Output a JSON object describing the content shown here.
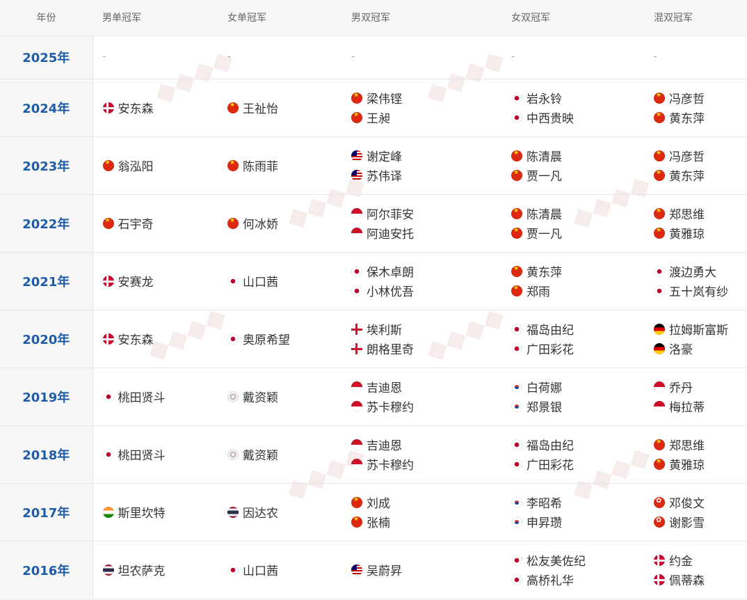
{
  "columns": [
    "年份",
    "男单冠军",
    "女单冠军",
    "男双冠军",
    "女双冠军",
    "混双冠军"
  ],
  "colors": {
    "year_text": "#1e5ba8",
    "header_bg": "#f7f7f7",
    "border": "#e6e6e6"
  },
  "rows": [
    {
      "year": "2025年",
      "ms": [],
      "ws": [],
      "md": [],
      "wd": [],
      "xd": [],
      "empty": "-"
    },
    {
      "year": "2024年",
      "ms": [
        {
          "flag": "dk",
          "name": "安东森"
        }
      ],
      "ws": [
        {
          "flag": "cn",
          "name": "王祉怡"
        }
      ],
      "md": [
        {
          "flag": "cn",
          "name": "梁伟铿"
        },
        {
          "flag": "cn",
          "name": "王昶"
        }
      ],
      "wd": [
        {
          "flag": "jp",
          "name": "岩永铃"
        },
        {
          "flag": "jp",
          "name": "中西贵映"
        }
      ],
      "xd": [
        {
          "flag": "cn",
          "name": "冯彦哲"
        },
        {
          "flag": "cn",
          "name": "黄东萍"
        }
      ]
    },
    {
      "year": "2023年",
      "ms": [
        {
          "flag": "cn",
          "name": "翁泓阳"
        }
      ],
      "ws": [
        {
          "flag": "cn",
          "name": "陈雨菲"
        }
      ],
      "md": [
        {
          "flag": "my",
          "name": "谢定峰"
        },
        {
          "flag": "my",
          "name": "苏伟译"
        }
      ],
      "wd": [
        {
          "flag": "cn",
          "name": "陈清晨"
        },
        {
          "flag": "cn",
          "name": "贾一凡"
        }
      ],
      "xd": [
        {
          "flag": "cn",
          "name": "冯彦哲"
        },
        {
          "flag": "cn",
          "name": "黄东萍"
        }
      ]
    },
    {
      "year": "2022年",
      "ms": [
        {
          "flag": "cn",
          "name": "石宇奇"
        }
      ],
      "ws": [
        {
          "flag": "cn",
          "name": "何冰娇"
        }
      ],
      "md": [
        {
          "flag": "id",
          "name": "阿尔菲安"
        },
        {
          "flag": "id",
          "name": "阿迪安托"
        }
      ],
      "wd": [
        {
          "flag": "cn",
          "name": "陈清晨"
        },
        {
          "flag": "cn",
          "name": "贾一凡"
        }
      ],
      "xd": [
        {
          "flag": "cn",
          "name": "郑思维"
        },
        {
          "flag": "cn",
          "name": "黄雅琼"
        }
      ]
    },
    {
      "year": "2021年",
      "ms": [
        {
          "flag": "dk",
          "name": "安赛龙"
        }
      ],
      "ws": [
        {
          "flag": "jp",
          "name": "山口茜"
        }
      ],
      "md": [
        {
          "flag": "jp",
          "name": "保木卓朗"
        },
        {
          "flag": "jp",
          "name": "小林优吾"
        }
      ],
      "wd": [
        {
          "flag": "cn",
          "name": "黄东萍"
        },
        {
          "flag": "cn",
          "name": "郑雨"
        }
      ],
      "xd": [
        {
          "flag": "jp",
          "name": "渡边勇大"
        },
        {
          "flag": "jp",
          "name": "五十岚有纱"
        }
      ]
    },
    {
      "year": "2020年",
      "ms": [
        {
          "flag": "dk",
          "name": "安东森"
        }
      ],
      "ws": [
        {
          "flag": "jp",
          "name": "奥原希望"
        }
      ],
      "md": [
        {
          "flag": "en",
          "name": "埃利斯"
        },
        {
          "flag": "en",
          "name": "朗格里奇"
        }
      ],
      "wd": [
        {
          "flag": "jp",
          "name": "福岛由纪"
        },
        {
          "flag": "jp",
          "name": "广田彩花"
        }
      ],
      "xd": [
        {
          "flag": "de",
          "name": "拉姆斯富斯"
        },
        {
          "flag": "de",
          "name": "洛豪"
        }
      ]
    },
    {
      "year": "2019年",
      "ms": [
        {
          "flag": "jp",
          "name": "桃田贤斗"
        }
      ],
      "ws": [
        {
          "flag": "tpe",
          "name": "戴资颖"
        }
      ],
      "md": [
        {
          "flag": "id",
          "name": "吉迪恩"
        },
        {
          "flag": "id",
          "name": "苏卡穆约"
        }
      ],
      "wd": [
        {
          "flag": "kr",
          "name": "白荷娜"
        },
        {
          "flag": "kr",
          "name": "郑景银"
        }
      ],
      "xd": [
        {
          "flag": "id",
          "name": "乔丹"
        },
        {
          "flag": "id",
          "name": "梅拉蒂"
        }
      ]
    },
    {
      "year": "2018年",
      "ms": [
        {
          "flag": "jp",
          "name": "桃田贤斗"
        }
      ],
      "ws": [
        {
          "flag": "tpe",
          "name": "戴资颖"
        }
      ],
      "md": [
        {
          "flag": "id",
          "name": "吉迪恩"
        },
        {
          "flag": "id",
          "name": "苏卡穆约"
        }
      ],
      "wd": [
        {
          "flag": "jp",
          "name": "福岛由纪"
        },
        {
          "flag": "jp",
          "name": "广田彩花"
        }
      ],
      "xd": [
        {
          "flag": "cn",
          "name": "郑思维"
        },
        {
          "flag": "cn",
          "name": "黄雅琼"
        }
      ]
    },
    {
      "year": "2017年",
      "ms": [
        {
          "flag": "in",
          "name": "斯里坎特"
        }
      ],
      "ws": [
        {
          "flag": "th",
          "name": "因达农"
        }
      ],
      "md": [
        {
          "flag": "cn",
          "name": "刘成"
        },
        {
          "flag": "cn",
          "name": "张楠"
        }
      ],
      "wd": [
        {
          "flag": "kr",
          "name": "李昭希"
        },
        {
          "flag": "kr",
          "name": "申昇瓒"
        }
      ],
      "xd": [
        {
          "flag": "hk",
          "name": "邓俊文"
        },
        {
          "flag": "hk",
          "name": "谢影雪"
        }
      ]
    },
    {
      "year": "2016年",
      "ms": [
        {
          "flag": "th",
          "name": "坦农萨克"
        }
      ],
      "ws": [
        {
          "flag": "jp",
          "name": "山口茜"
        }
      ],
      "md": [
        {
          "flag": "my",
          "name": "吴蔚昇"
        }
      ],
      "wd": [
        {
          "flag": "jp",
          "name": "松友美佐纪"
        },
        {
          "flag": "jp",
          "name": "高桥礼华"
        }
      ],
      "xd": [
        {
          "flag": "dk",
          "name": "约金"
        },
        {
          "flag": "dk",
          "name": "佩蒂森"
        }
      ]
    }
  ]
}
